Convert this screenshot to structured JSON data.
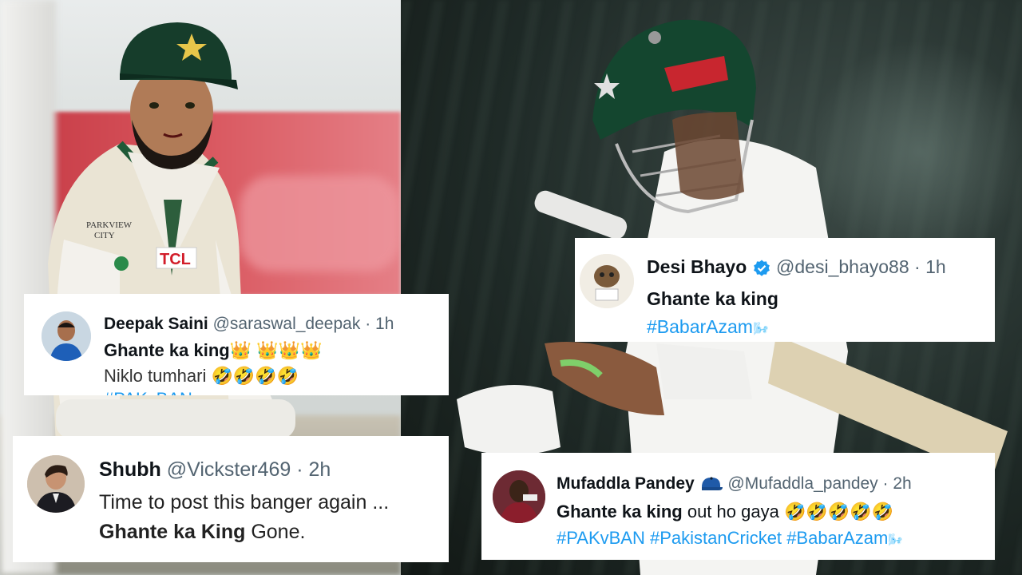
{
  "tweets": [
    {
      "name": "Deepak Saini",
      "handle": "@saraswal_deepak",
      "time": "1h",
      "line1": "Ghante ka king",
      "line1_emoji": "👑 👑👑👑",
      "line2": "Niklo tumhari",
      "line2_emoji": "🤣🤣🤣🤣",
      "line3_partial": "#PAKvBAN"
    },
    {
      "name": "Desi Bhayo",
      "handle": "@desi_bhayo88",
      "time": "1h",
      "line1": "Ghante ka king",
      "line2_tag": "#BabarAzam",
      "line2_emoji": "🌬️"
    },
    {
      "name": "Shubh",
      "handle": "@Vickster469",
      "time": "2h",
      "line1": "Time to post this banger again ...",
      "line2_bold": "Ghante ka King",
      "line2_rest": " Gone."
    },
    {
      "name": "Mufaddla Pandey",
      "handle": "@Mufaddla_pandey",
      "time": "2h",
      "line1_bold": "Ghante ka king",
      "line1_rest": " out ho gaya ",
      "line1_emoji": "🤣🤣🤣🤣🤣",
      "line2_tags": [
        "#PAKvBAN",
        "#PakistanCricket",
        "#BabarAzam"
      ],
      "line2_emoji": "🌬️"
    }
  ],
  "separator": "·",
  "colors": {
    "link": "#1d9bf0",
    "name": "#0f1419",
    "meta": "#536471",
    "verified": "#1d9bf0"
  },
  "icons": [
    "verified-badge-icon",
    "cap-icon"
  ]
}
